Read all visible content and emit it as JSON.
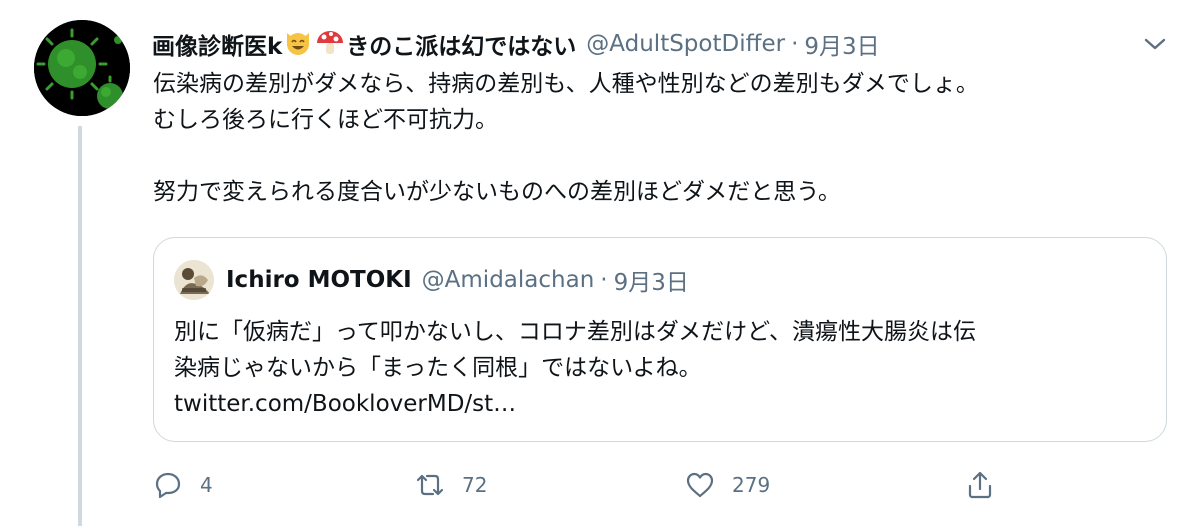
{
  "tweet": {
    "display_name": "画像診断医k",
    "display_name_suffix": "きのこ派は幻ではない",
    "handle": "@AdultSpotDiffer",
    "separator": "·",
    "date": "9月3日",
    "text_lines": [
      "伝染病の差別がダメなら、持病の差別も、人種や性別などの差別もダメでしょ。",
      "むしろ後ろに行くほど不可抗力。",
      "努力で変えられる度合いが少ないものへの差別ほどダメだと思う。"
    ],
    "avatar_icon": "green-virus-avatar",
    "emojis": [
      "smiling-cat-icon",
      "mushroom-icon"
    ]
  },
  "quote": {
    "display_name": "Ichiro MOTOKI",
    "handle": "@Amidalachan",
    "separator": "·",
    "date": "9月3日",
    "text_lines": [
      "別に「仮病だ」って叩かないし、コロナ差別はダメだけど、潰瘍性大腸炎は伝",
      "染病じゃないから「まったく同根」ではないよね。",
      "twitter.com/BookloverMD/st…"
    ]
  },
  "actions": {
    "reply_count": "4",
    "retweet_count": "72",
    "like_count": "279"
  },
  "colors": {
    "text": "#0f1419",
    "secondary": "#5b7083",
    "border": "#cfd9de"
  }
}
